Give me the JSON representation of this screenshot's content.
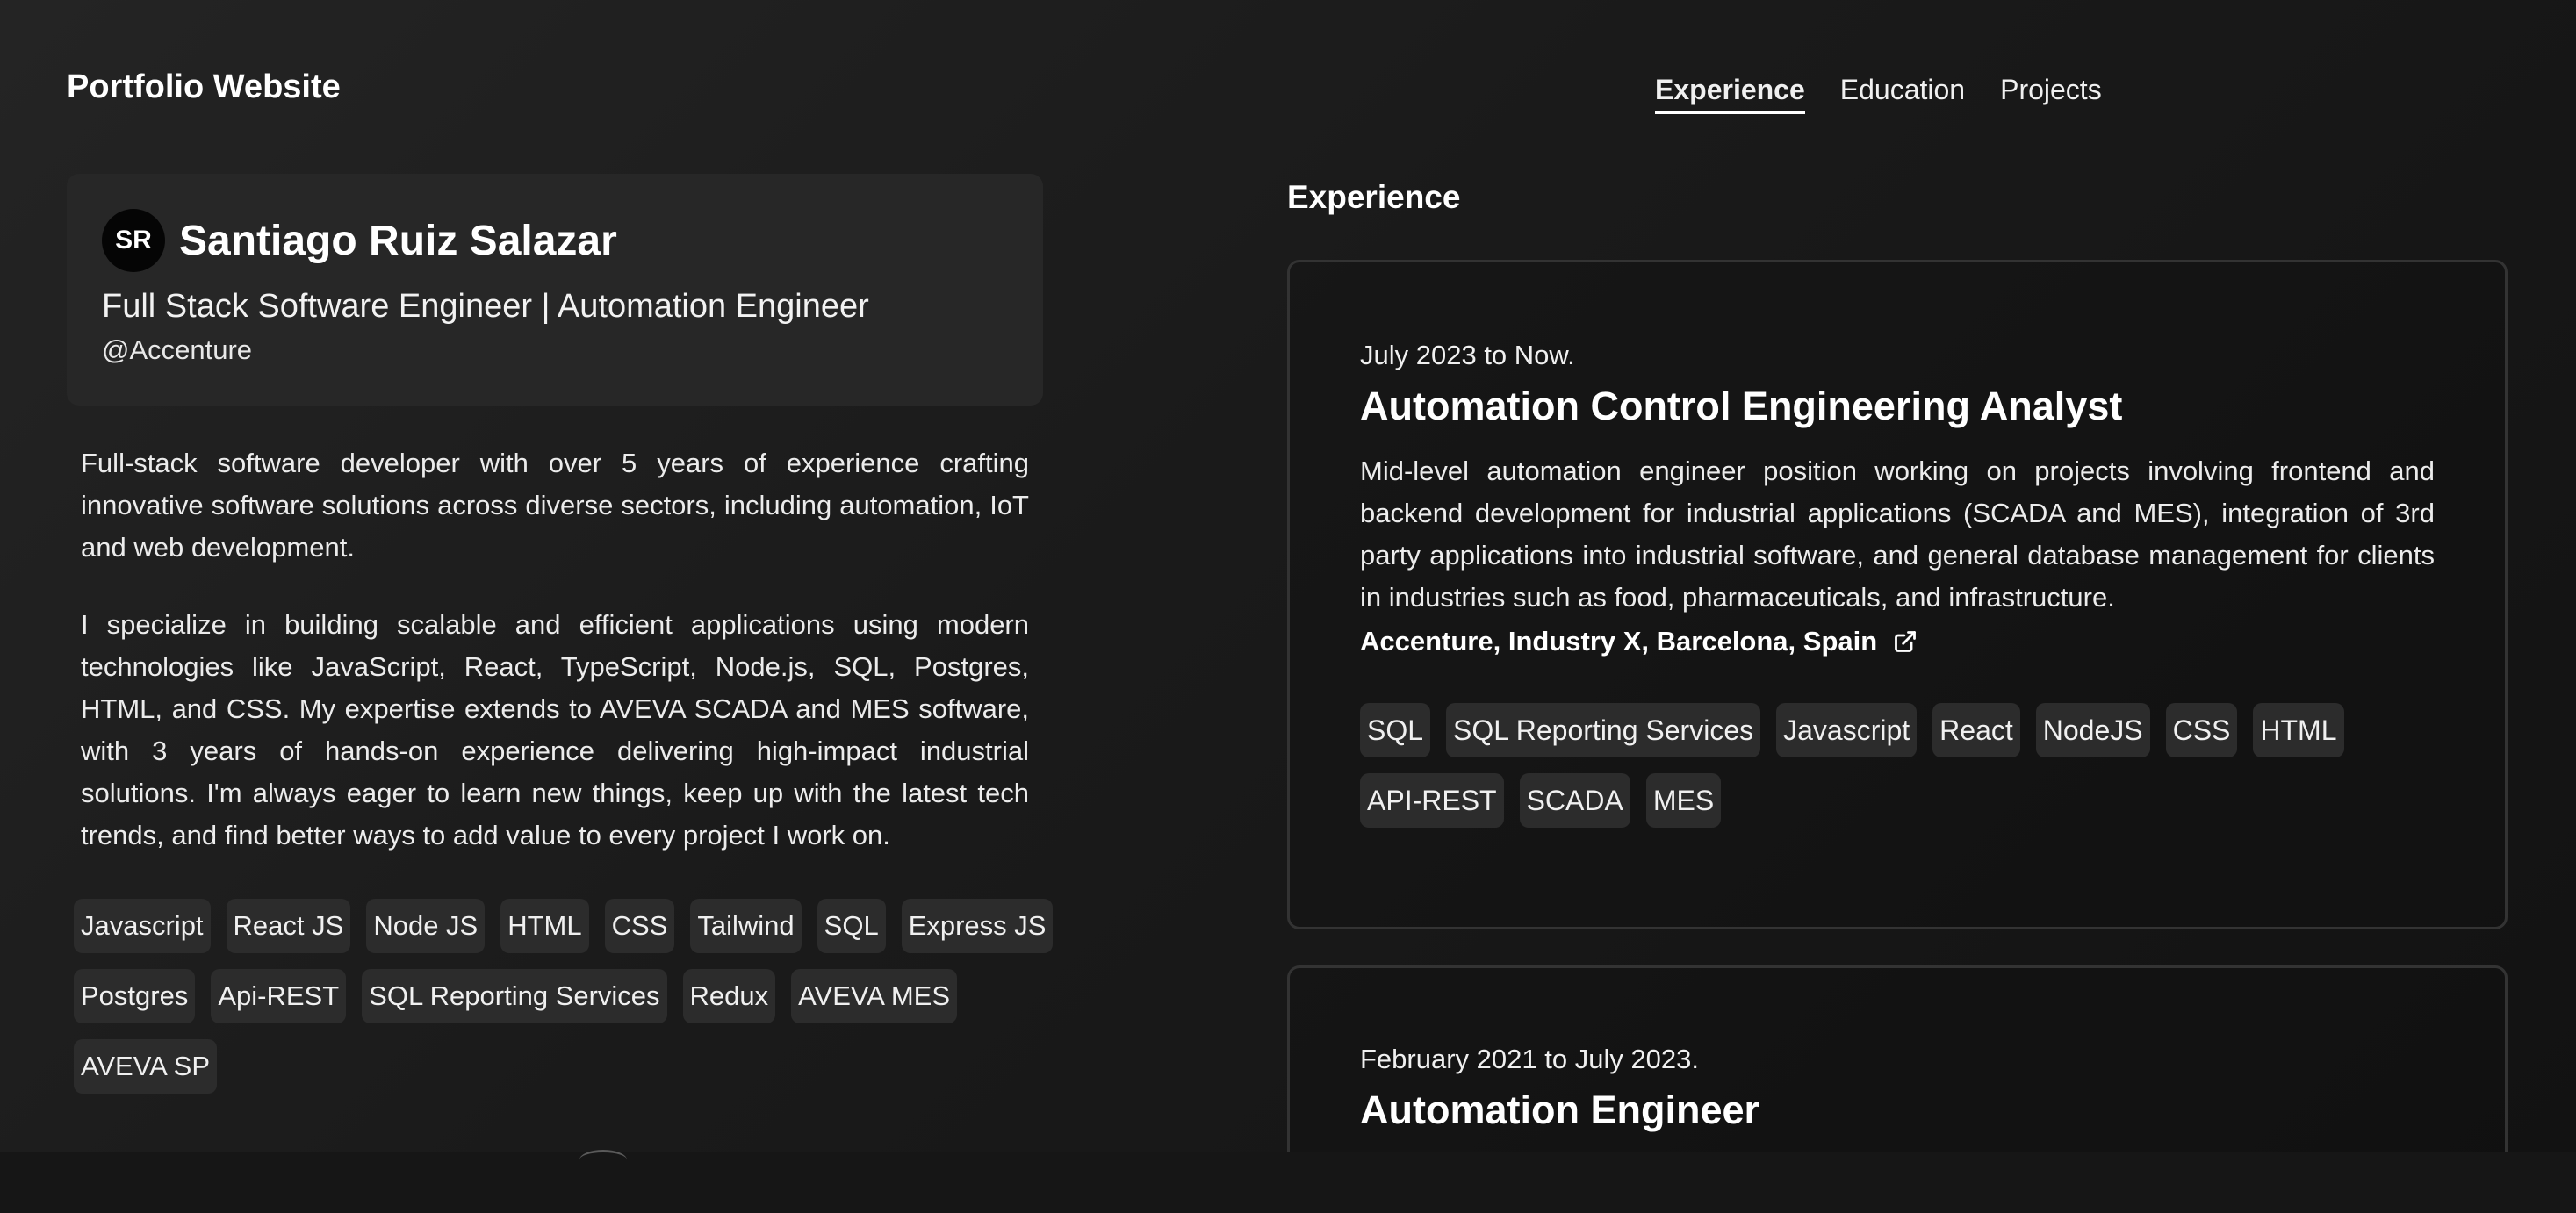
{
  "header": {
    "site_title": "Portfolio Website",
    "nav": [
      {
        "label": "Experience",
        "active": true
      },
      {
        "label": "Education",
        "active": false
      },
      {
        "label": "Projects",
        "active": false
      }
    ]
  },
  "profile": {
    "initials": "SR",
    "name": "Santiago Ruiz Salazar",
    "role": "Full Stack Software Engineer | Automation Engineer",
    "company": "@Accenture",
    "bio": [
      "Full-stack software developer with over 5 years of experience crafting innovative software solutions across diverse sectors, including automation, IoT and web development.",
      "I specialize in building scalable and efficient applications using modern technologies like JavaScript, React, TypeScript, Node.js, SQL, Postgres, HTML, and CSS. My expertise extends to AVEVA SCADA and MES software, with 3 years of hands-on experience delivering high-impact industrial solutions. I'm always eager to learn new things, keep up with the latest tech trends, and find better ways to add value to every project I work on."
    ],
    "skills": [
      "Javascript",
      "React JS",
      "Node JS",
      "HTML",
      "CSS",
      "Tailwind",
      "SQL",
      "Express JS",
      "Postgres",
      "Api-REST",
      "SQL Reporting Services",
      "Redux",
      "AVEVA MES",
      "AVEVA SP"
    ]
  },
  "experience": {
    "section_title": "Experience",
    "items": [
      {
        "date": "July 2023 to Now.",
        "title": "Automation Control Engineering Analyst",
        "description": "Mid-level automation engineer position working on projects involving frontend and backend development for industrial applications (SCADA and MES), integration of 3rd party applications into industrial software, and general database management for clients in industries such as food, pharmaceuticals, and infrastructure.",
        "company": "Accenture, Industry X, Barcelona, Spain",
        "link_icon": "external-link-icon",
        "tags": [
          "SQL",
          "SQL Reporting Services",
          "Javascript",
          "React",
          "NodeJS",
          "CSS",
          "HTML",
          "API-REST",
          "SCADA",
          "MES"
        ]
      },
      {
        "date": "February 2021 to July 2023.",
        "title": "Automation Engineer"
      }
    ]
  },
  "colors": {
    "background": "#1a1a1a",
    "card": "#272727",
    "tag": "#2c2c2c",
    "border": "#333333",
    "text": "#f2f2f2"
  }
}
